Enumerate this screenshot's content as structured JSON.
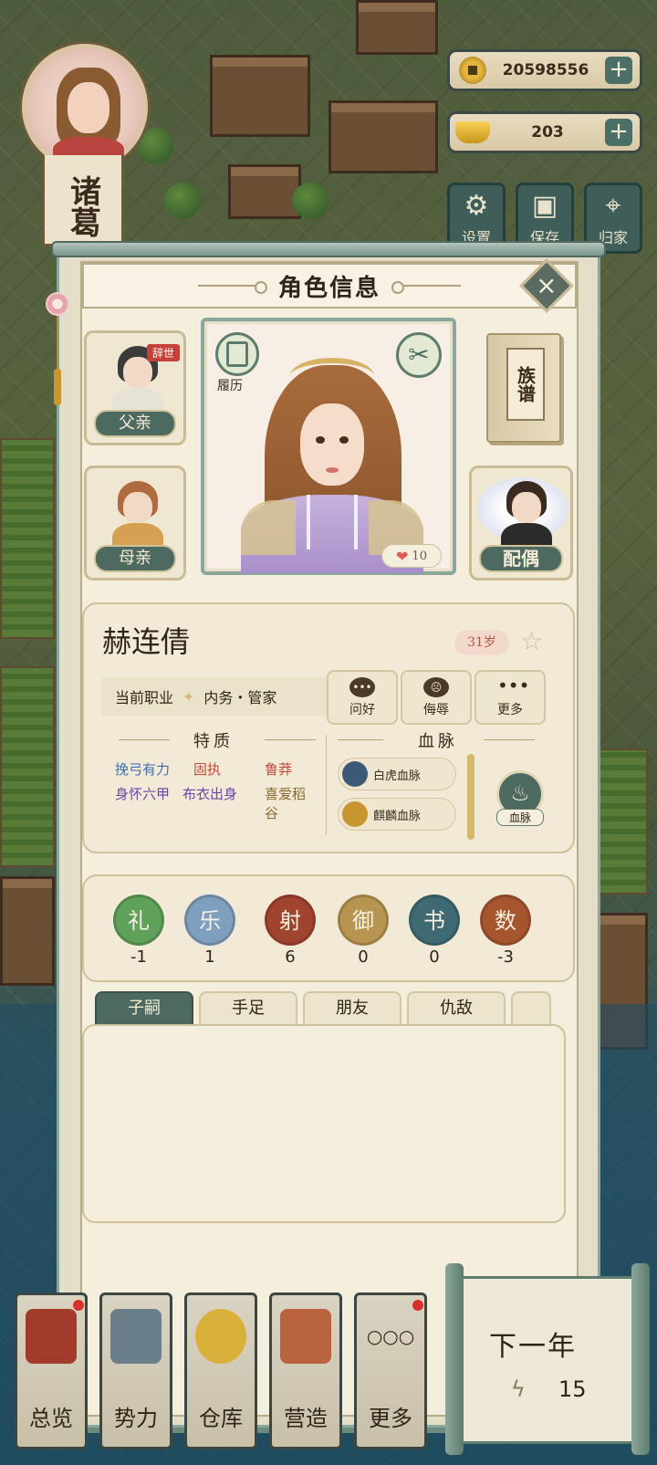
{
  "top_left": {
    "name_banner": "诸葛"
  },
  "currency": {
    "coins": "20598556",
    "ingots": "203",
    "plus": "+"
  },
  "top_buttons": [
    {
      "label": "设置",
      "icon": "gear-icon",
      "glyph": "⚙"
    },
    {
      "label": "保存",
      "icon": "save-icon",
      "glyph": "▣"
    },
    {
      "label": "归家",
      "icon": "home-pin-icon",
      "glyph": "⌖"
    }
  ],
  "panel": {
    "title": "角色信息",
    "close": "×"
  },
  "relatives": {
    "father": {
      "label": "父亲",
      "badge": "辞世"
    },
    "mother": {
      "label": "母亲"
    },
    "spouse": {
      "label": "配偶"
    },
    "genealogy": "族谱"
  },
  "portrait": {
    "resume": "履历",
    "favor": "10",
    "heart": "❤",
    "scissor": "✂"
  },
  "character": {
    "name": "赫连倩",
    "age": "31岁",
    "star": "☆",
    "job_label": "当前职业",
    "job_sep": "✦",
    "job_value": "内务・管家"
  },
  "actions": [
    {
      "label": "问好",
      "glyph": "•••"
    },
    {
      "label": "侮辱",
      "glyph": "☹"
    },
    {
      "label": "更多",
      "glyph": "•••"
    }
  ],
  "traits_title": "特质",
  "traits": [
    {
      "text": "挽弓有力",
      "color": "#3e6fb0"
    },
    {
      "text": "固执",
      "color": "#c24a3a"
    },
    {
      "text": "鲁莽",
      "color": "#c24a3a"
    },
    {
      "text": "身怀六甲",
      "color": "#6a46a8"
    },
    {
      "text": "布衣出身",
      "color": "#6a46a8"
    },
    {
      "text": "喜爱稻谷",
      "color": "#8a6d2c"
    }
  ],
  "bloodline_title": "血脉",
  "bloodlines": [
    {
      "text": "白虎血脉",
      "color": "#3c5a78"
    },
    {
      "text": "麒麟血脉",
      "color": "#c8962f"
    }
  ],
  "bloodline_button": {
    "label": "血脉",
    "glyph": "♨"
  },
  "arts": [
    {
      "char": "礼",
      "value": "-1",
      "color": "#5fa05a"
    },
    {
      "char": "乐",
      "value": "1",
      "color": "#7f9fbf"
    },
    {
      "char": "射",
      "value": "6",
      "color": "#a0432f"
    },
    {
      "char": "御",
      "value": "0",
      "color": "#b89452"
    },
    {
      "char": "书",
      "value": "0",
      "color": "#3f6a73"
    },
    {
      "char": "数",
      "value": "-3",
      "color": "#a6552f"
    }
  ],
  "tabs": [
    "子嗣",
    "手足",
    "朋友",
    "仇敌"
  ],
  "bottom_nav": [
    {
      "label": "总览",
      "icon": "scroll-brush-icon",
      "dot": true
    },
    {
      "label": "势力",
      "icon": "palace-icon",
      "dot": false
    },
    {
      "label": "仓库",
      "icon": "money-bag-icon",
      "dot": false
    },
    {
      "label": "营造",
      "icon": "trowel-bricks-icon",
      "dot": false
    },
    {
      "label": "更多",
      "icon": "more-icon",
      "dot": true,
      "glyph": "○○○"
    }
  ],
  "next_year": {
    "label": "下一年",
    "bolt": "ϟ",
    "energy": "15"
  }
}
